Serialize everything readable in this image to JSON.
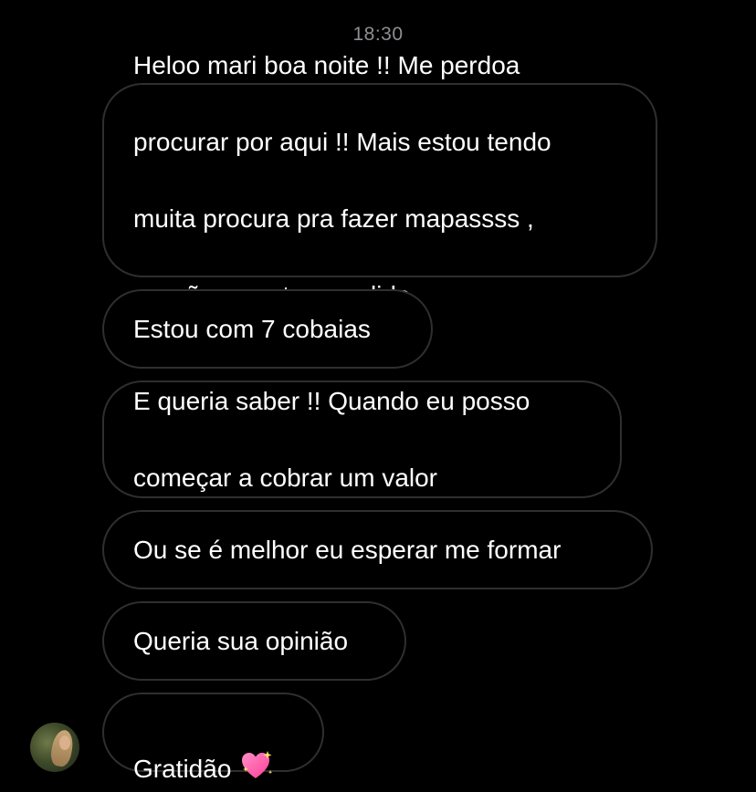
{
  "timestamp": "18:30",
  "messages": [
    {
      "lines": [
        "Heloo mari boa noite !! Me perdoa",
        "procurar por aqui !! Mais estou tendo",
        "muita procura pra fazer mapassss ,",
        "sessões  e estou perdida"
      ]
    },
    {
      "lines": [
        "Estou com 7 cobaias"
      ]
    },
    {
      "lines": [
        "E queria saber !! Quando eu posso",
        "começar a cobrar um valor"
      ]
    },
    {
      "lines": [
        "Ou se é melhor eu esperar me formar"
      ]
    },
    {
      "lines": [
        "Queria sua opinião"
      ]
    },
    {
      "lines": [
        "Gratidão"
      ],
      "emoji": "sparkling-heart"
    }
  ],
  "colors": {
    "background": "#000000",
    "bubble_border": "#2f2f2f",
    "text": "#ffffff",
    "timestamp": "#8e8e93",
    "heart": "#ff5fa8"
  }
}
